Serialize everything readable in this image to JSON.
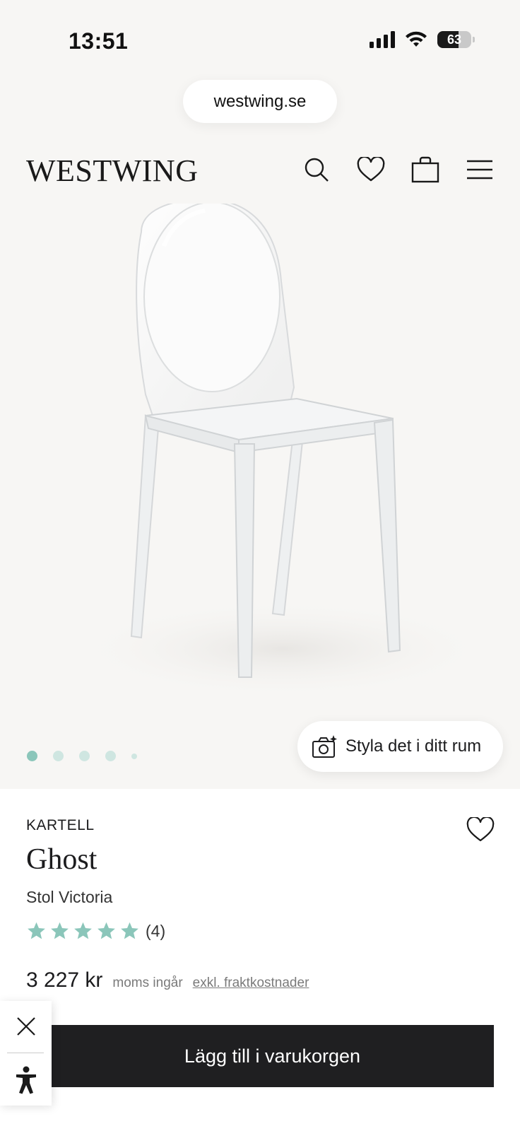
{
  "status_bar": {
    "time": "13:51",
    "battery_level": "63",
    "battery_fraction": 0.63
  },
  "browser": {
    "url": "westwing.se"
  },
  "header": {
    "logo": "WESTWING",
    "icons": [
      "search-icon",
      "heart-icon",
      "shopping-bag-icon",
      "menu-icon"
    ]
  },
  "gallery": {
    "image": "transparent-ghost-chair",
    "slide_count": 5,
    "active_slide": 1,
    "style_button_label": "Styla det i ditt rum"
  },
  "product": {
    "brand": "KARTELL",
    "name": "Ghost",
    "subtitle": "Stol Victoria",
    "rating": 5,
    "rating_count": "(4)",
    "price": "3 227 kr",
    "vat_note": "moms ingår",
    "shipping_link": "exkl. fraktkostnader",
    "add_to_cart": "Lägg till i varukorgen"
  },
  "colors": {
    "accent": "#8bc6ba",
    "button_dark": "#1f1f21",
    "background": "#f7f6f4"
  }
}
